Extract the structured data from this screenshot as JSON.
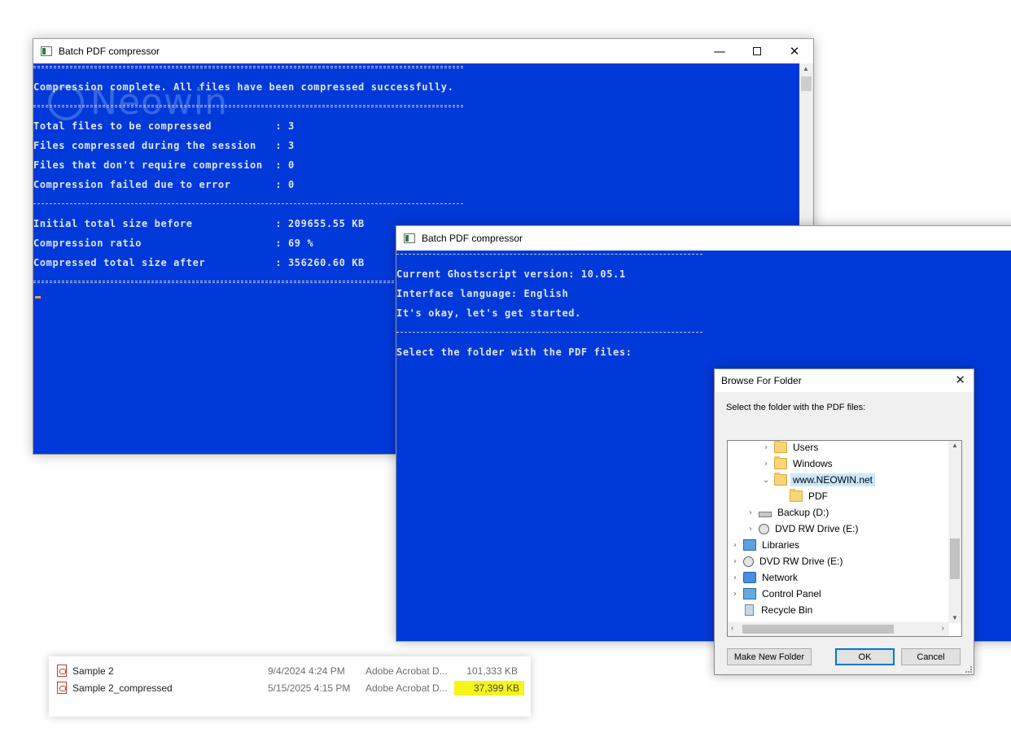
{
  "console1": {
    "title": "Batch PDF compressor",
    "watermark": "Neowin",
    "lines": [
      "Compression complete. All files have been compressed successfully.",
      "Total files to be compressed          : 3",
      "Files compressed during the session   : 3",
      "Files that don't require compression  : 0",
      "Compression failed due to error       : 0",
      "Initial total size before             : 209655.55 KB",
      "Compression ratio                     : 69 %",
      "Compressed total size after           : 356260.60 KB"
    ]
  },
  "window_controls": {
    "minimize": "—",
    "maximize": "",
    "close": "✕"
  },
  "console2": {
    "title": "Batch PDF compressor",
    "lines": [
      "Current Ghostscript version: 10.05.1",
      "Interface language: English",
      "It's okay, let's get started.",
      "Select the folder with the PDF files:"
    ]
  },
  "dialog": {
    "title": "Browse For Folder",
    "close": "✕",
    "prompt": "Select the folder with the PDF files:",
    "tree": [
      {
        "label": "Users",
        "icon": "folder-icon",
        "expander": "›"
      },
      {
        "label": "Windows",
        "icon": "folder-icon",
        "expander": "›"
      },
      {
        "label": "www.NEOWIN.net",
        "icon": "folder-icon",
        "expander": "⌄",
        "selected": true
      },
      {
        "label": "PDF",
        "icon": "folder-icon",
        "expander": ""
      },
      {
        "label": "Backup (D:)",
        "icon": "drive-icon",
        "expander": "›"
      },
      {
        "label": "DVD RW Drive (E:)",
        "icon": "dvd-icon",
        "expander": "›"
      },
      {
        "label": "Libraries",
        "icon": "libraries-icon",
        "expander": "›"
      },
      {
        "label": "DVD RW Drive (E:)",
        "icon": "dvd-icon",
        "expander": "›"
      },
      {
        "label": "Network",
        "icon": "network-icon",
        "expander": "›"
      },
      {
        "label": "Control Panel",
        "icon": "control-panel-icon",
        "expander": "›"
      },
      {
        "label": "Recycle Bin",
        "icon": "recycle-bin-icon",
        "expander": ""
      }
    ],
    "buttons": {
      "new_folder": "Make New Folder",
      "ok": "OK",
      "cancel": "Cancel"
    }
  },
  "file_list": [
    {
      "name": "Sample 2",
      "date": "9/4/2024 4:24 PM",
      "type": "Adobe Acrobat D...",
      "size": "101,333 KB"
    },
    {
      "name": "Sample 2_compressed",
      "date": "5/15/2025 4:15 PM",
      "type": "Adobe Acrobat D...",
      "size": "37,399 KB"
    }
  ],
  "colors": {
    "console_bg": "#0039d9",
    "highlight": "#f5f51a",
    "selection": "#cce8ff"
  }
}
